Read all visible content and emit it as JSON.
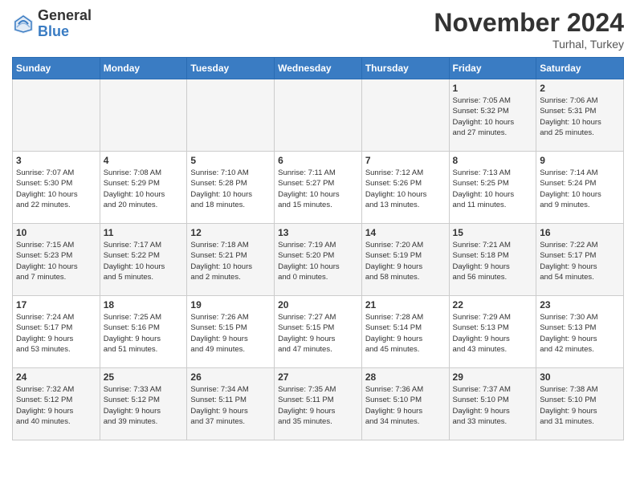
{
  "header": {
    "logo_general": "General",
    "logo_blue": "Blue",
    "month_year": "November 2024",
    "location": "Turhal, Turkey"
  },
  "weekdays": [
    "Sunday",
    "Monday",
    "Tuesday",
    "Wednesday",
    "Thursday",
    "Friday",
    "Saturday"
  ],
  "weeks": [
    [
      {
        "day": "",
        "info": ""
      },
      {
        "day": "",
        "info": ""
      },
      {
        "day": "",
        "info": ""
      },
      {
        "day": "",
        "info": ""
      },
      {
        "day": "",
        "info": ""
      },
      {
        "day": "1",
        "info": "Sunrise: 7:05 AM\nSunset: 5:32 PM\nDaylight: 10 hours\nand 27 minutes."
      },
      {
        "day": "2",
        "info": "Sunrise: 7:06 AM\nSunset: 5:31 PM\nDaylight: 10 hours\nand 25 minutes."
      }
    ],
    [
      {
        "day": "3",
        "info": "Sunrise: 7:07 AM\nSunset: 5:30 PM\nDaylight: 10 hours\nand 22 minutes."
      },
      {
        "day": "4",
        "info": "Sunrise: 7:08 AM\nSunset: 5:29 PM\nDaylight: 10 hours\nand 20 minutes."
      },
      {
        "day": "5",
        "info": "Sunrise: 7:10 AM\nSunset: 5:28 PM\nDaylight: 10 hours\nand 18 minutes."
      },
      {
        "day": "6",
        "info": "Sunrise: 7:11 AM\nSunset: 5:27 PM\nDaylight: 10 hours\nand 15 minutes."
      },
      {
        "day": "7",
        "info": "Sunrise: 7:12 AM\nSunset: 5:26 PM\nDaylight: 10 hours\nand 13 minutes."
      },
      {
        "day": "8",
        "info": "Sunrise: 7:13 AM\nSunset: 5:25 PM\nDaylight: 10 hours\nand 11 minutes."
      },
      {
        "day": "9",
        "info": "Sunrise: 7:14 AM\nSunset: 5:24 PM\nDaylight: 10 hours\nand 9 minutes."
      }
    ],
    [
      {
        "day": "10",
        "info": "Sunrise: 7:15 AM\nSunset: 5:23 PM\nDaylight: 10 hours\nand 7 minutes."
      },
      {
        "day": "11",
        "info": "Sunrise: 7:17 AM\nSunset: 5:22 PM\nDaylight: 10 hours\nand 5 minutes."
      },
      {
        "day": "12",
        "info": "Sunrise: 7:18 AM\nSunset: 5:21 PM\nDaylight: 10 hours\nand 2 minutes."
      },
      {
        "day": "13",
        "info": "Sunrise: 7:19 AM\nSunset: 5:20 PM\nDaylight: 10 hours\nand 0 minutes."
      },
      {
        "day": "14",
        "info": "Sunrise: 7:20 AM\nSunset: 5:19 PM\nDaylight: 9 hours\nand 58 minutes."
      },
      {
        "day": "15",
        "info": "Sunrise: 7:21 AM\nSunset: 5:18 PM\nDaylight: 9 hours\nand 56 minutes."
      },
      {
        "day": "16",
        "info": "Sunrise: 7:22 AM\nSunset: 5:17 PM\nDaylight: 9 hours\nand 54 minutes."
      }
    ],
    [
      {
        "day": "17",
        "info": "Sunrise: 7:24 AM\nSunset: 5:17 PM\nDaylight: 9 hours\nand 53 minutes."
      },
      {
        "day": "18",
        "info": "Sunrise: 7:25 AM\nSunset: 5:16 PM\nDaylight: 9 hours\nand 51 minutes."
      },
      {
        "day": "19",
        "info": "Sunrise: 7:26 AM\nSunset: 5:15 PM\nDaylight: 9 hours\nand 49 minutes."
      },
      {
        "day": "20",
        "info": "Sunrise: 7:27 AM\nSunset: 5:15 PM\nDaylight: 9 hours\nand 47 minutes."
      },
      {
        "day": "21",
        "info": "Sunrise: 7:28 AM\nSunset: 5:14 PM\nDaylight: 9 hours\nand 45 minutes."
      },
      {
        "day": "22",
        "info": "Sunrise: 7:29 AM\nSunset: 5:13 PM\nDaylight: 9 hours\nand 43 minutes."
      },
      {
        "day": "23",
        "info": "Sunrise: 7:30 AM\nSunset: 5:13 PM\nDaylight: 9 hours\nand 42 minutes."
      }
    ],
    [
      {
        "day": "24",
        "info": "Sunrise: 7:32 AM\nSunset: 5:12 PM\nDaylight: 9 hours\nand 40 minutes."
      },
      {
        "day": "25",
        "info": "Sunrise: 7:33 AM\nSunset: 5:12 PM\nDaylight: 9 hours\nand 39 minutes."
      },
      {
        "day": "26",
        "info": "Sunrise: 7:34 AM\nSunset: 5:11 PM\nDaylight: 9 hours\nand 37 minutes."
      },
      {
        "day": "27",
        "info": "Sunrise: 7:35 AM\nSunset: 5:11 PM\nDaylight: 9 hours\nand 35 minutes."
      },
      {
        "day": "28",
        "info": "Sunrise: 7:36 AM\nSunset: 5:10 PM\nDaylight: 9 hours\nand 34 minutes."
      },
      {
        "day": "29",
        "info": "Sunrise: 7:37 AM\nSunset: 5:10 PM\nDaylight: 9 hours\nand 33 minutes."
      },
      {
        "day": "30",
        "info": "Sunrise: 7:38 AM\nSunset: 5:10 PM\nDaylight: 9 hours\nand 31 minutes."
      }
    ]
  ]
}
